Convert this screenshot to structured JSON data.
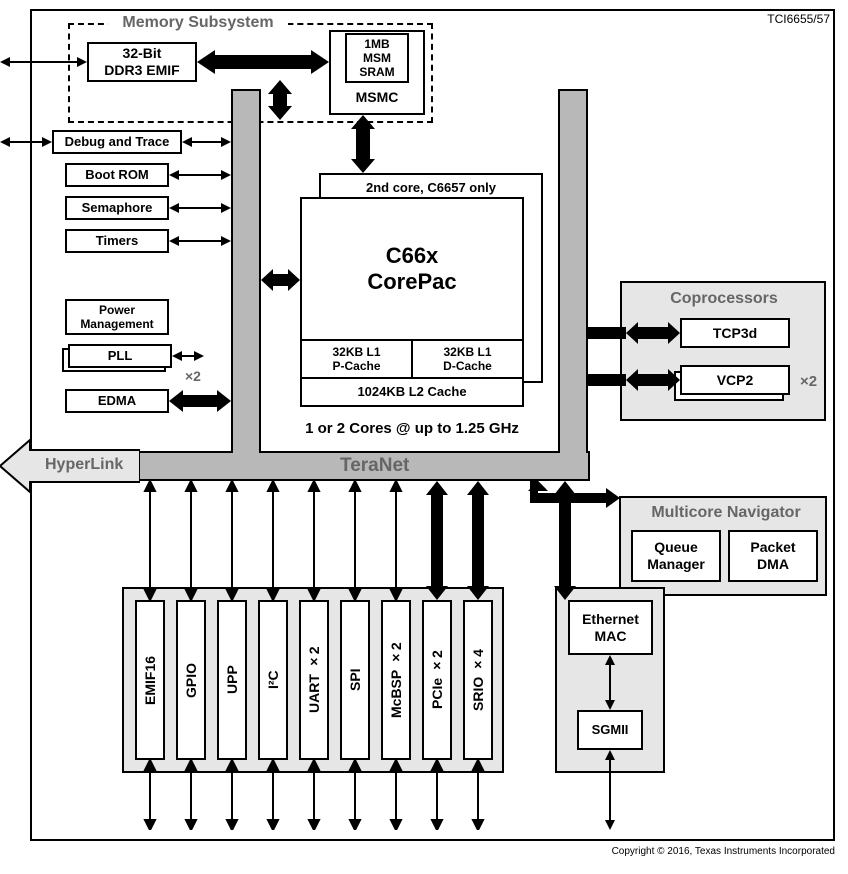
{
  "part_number": "TCI6655/57",
  "memory_subsystem": {
    "title": "Memory Subsystem",
    "ddr3": "32-Bit\nDDR3 EMIF",
    "msm": "1MB\nMSM\nSRAM",
    "msmc": "MSMC"
  },
  "left_blocks": {
    "debug": "Debug and Trace",
    "bootrom": "Boot ROM",
    "semaphore": "Semaphore",
    "timers": "Timers",
    "power": "Power\nManagement",
    "pll": "PLL",
    "pll_mult": "×2",
    "edma": "EDMA"
  },
  "corepac": {
    "second_core": "2nd core,  C6657 only",
    "title": "C66x\nCorePac",
    "l1p": "32KB L1\nP-Cache",
    "l1d": "32KB L1\nD-Cache",
    "l2": "1024KB L2 Cache",
    "speed": "1 or 2 Cores @ up to 1.25 GHz"
  },
  "coprocessors": {
    "title": "Coprocessors",
    "tcp3d": "TCP3d",
    "vcp2": "VCP2",
    "vcp2_mult": "×2"
  },
  "teranet": {
    "hyperlink": "HyperLink",
    "label": "TeraNet"
  },
  "navigator": {
    "title": "Multicore Navigator",
    "queue": "Queue\nManager",
    "pdma": "Packet\nDMA"
  },
  "peripherals": {
    "emif16": "EMIF16",
    "gpio": "GPIO",
    "upp": "UPP",
    "i2c": "I²C",
    "uart": "UART  ×2",
    "spi": "SPI",
    "mcbsp": "McBSP  ×2",
    "pcie": "PCIe  ×2",
    "srio": "SRIO  ×4"
  },
  "ethernet": {
    "mac": "Ethernet\nMAC",
    "sgmii": "SGMII"
  },
  "copyright": "Copyright © 2016, Texas Instruments Incorporated"
}
